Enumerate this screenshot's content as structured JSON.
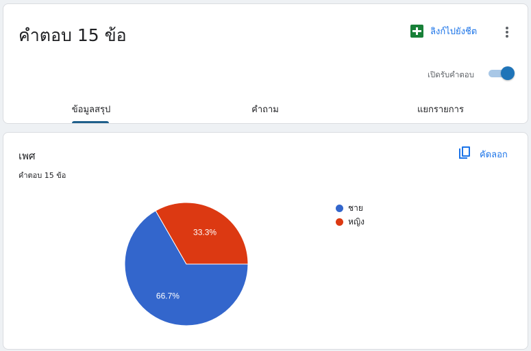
{
  "header": {
    "title": "คำตอบ 15 ข้อ",
    "sheet_link_label": "ลิงก์ไปยังชีต",
    "accepting_label": "เปิดรับคำตอบ",
    "accepting_responses": true
  },
  "tabs": [
    {
      "label": "ข้อมูลสรุป",
      "active": true
    },
    {
      "label": "คำถาม",
      "active": false
    },
    {
      "label": "แยกรายการ",
      "active": false
    }
  ],
  "question": {
    "title": "เพศ",
    "count_label": "คำตอบ 15 ข้อ",
    "copy_label": "คัดลอก"
  },
  "colors": {
    "accent": "#1a73e8",
    "sheets_green": "#188038",
    "series_male": "#3366cc",
    "series_female": "#dc3912"
  },
  "icons": [
    "sheets-icon",
    "more-vert-icon",
    "copy-icon"
  ],
  "chart_data": {
    "type": "pie",
    "categories": [
      "ชาย",
      "หญิง"
    ],
    "values": [
      66.7,
      33.3
    ],
    "labels": [
      "66.7%",
      "33.3%"
    ],
    "colors": [
      "#3366cc",
      "#dc3912"
    ],
    "legend_position": "right"
  }
}
